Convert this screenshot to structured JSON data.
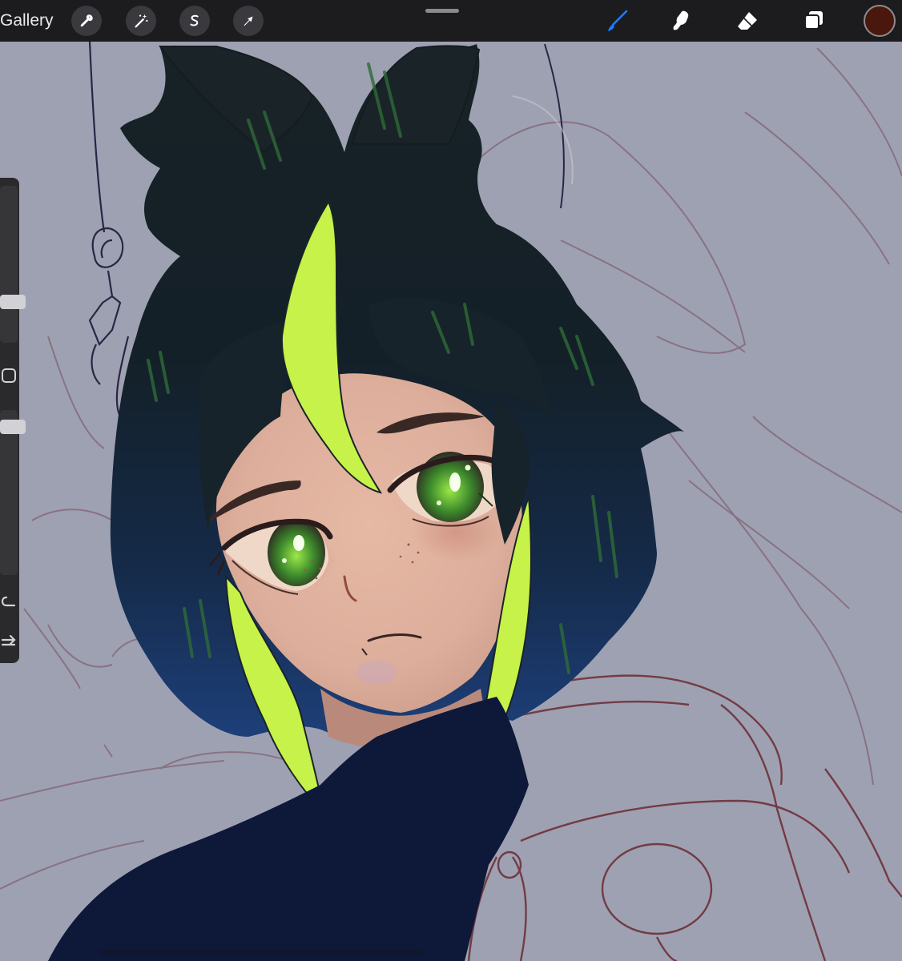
{
  "app": {
    "gallery_label": "Gallery",
    "current_color": "#4a170c",
    "accent_color": "#1f7bff"
  },
  "toolbar_left": {
    "actions_icon": "wrench-icon",
    "adjustments_icon": "magic-wand-icon",
    "selection_icon": "selection-s-icon",
    "transform_icon": "arrow-cursor-icon"
  },
  "toolbar_right": {
    "brush_icon": "brush-icon",
    "smudge_icon": "smudge-finger-icon",
    "eraser_icon": "eraser-icon",
    "layers_icon": "layers-icon",
    "active_tool": "brush"
  },
  "sidebar": {
    "brush_size_icon": "brush-size-slider",
    "opacity_icon": "opacity-slider",
    "modify_icon": "square-modify-icon",
    "undo_icon": "undo-icon",
    "redo_icon": "redo-icon"
  }
}
